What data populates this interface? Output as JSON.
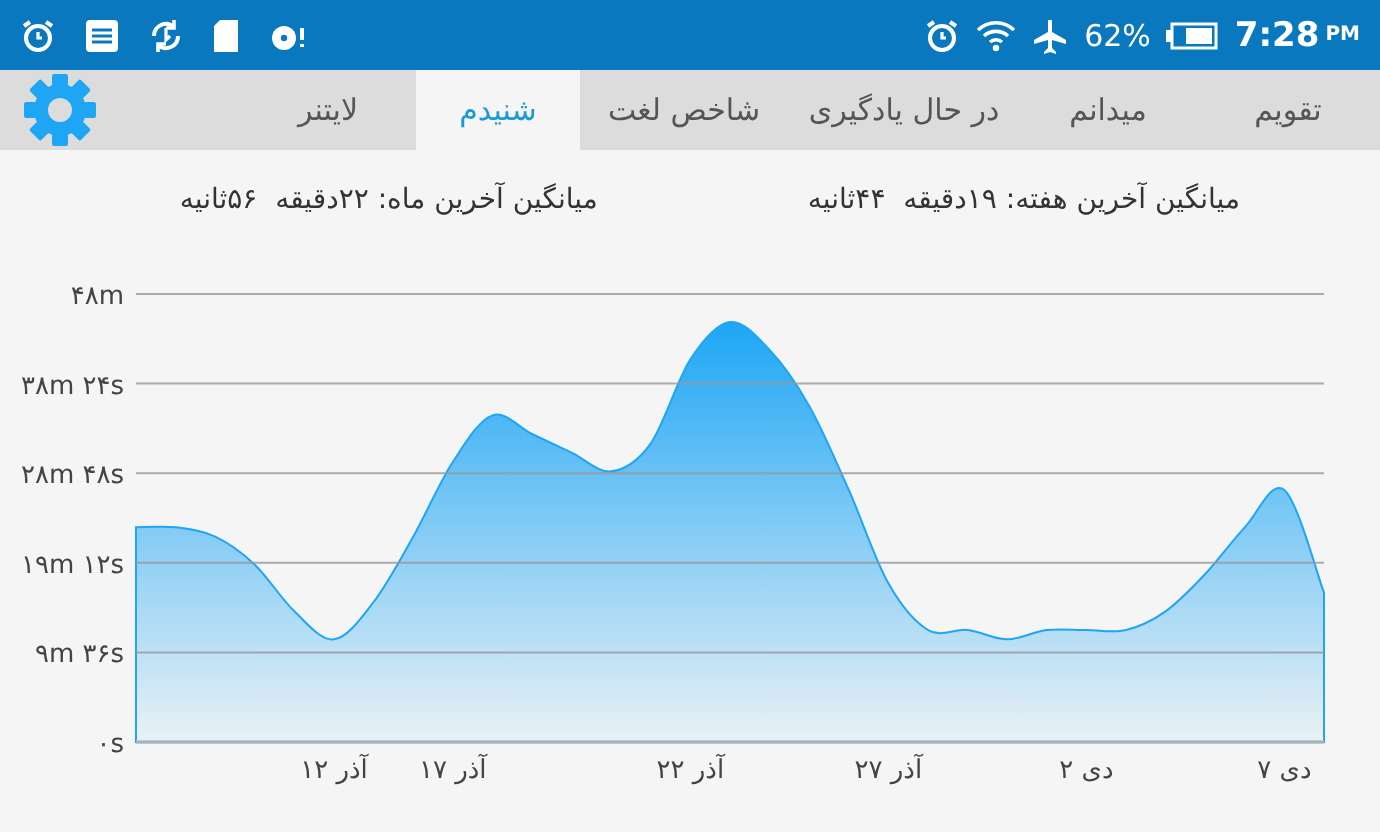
{
  "status_bar": {
    "battery": "62%",
    "time": "7:28",
    "ampm": "PM"
  },
  "tabs": [
    {
      "label": "تقویم",
      "selected": false
    },
    {
      "label": "میدانم",
      "selected": false
    },
    {
      "label": "در حال یادگیری",
      "selected": false
    },
    {
      "label": "شاخص لغت",
      "selected": false
    },
    {
      "label": "شنیدم",
      "selected": true
    },
    {
      "label": "لایتنر",
      "selected": false
    }
  ],
  "averages": [
    "میانگین آخرین هفته: ۱۹دقیقه  ۴۴ثانیه",
    "میانگین آخرین ماه: ۲۲دقیقه  ۵۶ثانیه"
  ],
  "chart_data": {
    "type": "area",
    "grid": true,
    "categories": [
      null,
      null,
      null,
      null,
      null,
      "۱۲ آذر",
      null,
      null,
      "۱۷ آذر",
      null,
      null,
      null,
      null,
      null,
      "۲۲ آذر",
      null,
      null,
      null,
      null,
      "۲۷ آذر",
      null,
      null,
      null,
      null,
      "۲ دی",
      null,
      null,
      null,
      null,
      "۷ دی",
      null
    ],
    "series": [
      {
        "color": "#1ea6f5",
        "values": [
          23,
          23,
          22,
          19,
          14,
          11,
          15,
          22,
          30,
          35,
          33,
          31,
          29,
          32,
          41,
          45,
          42,
          36,
          27,
          17,
          12,
          12,
          11,
          12,
          12,
          12,
          14,
          18,
          23,
          27,
          16
        ]
      }
    ],
    "ylim": [
      0,
      48
    ],
    "yticks": [
      {
        "value": 0,
        "label": "۰s"
      },
      {
        "value": 9.6,
        "label": "۹m ۳۶s"
      },
      {
        "value": 19.2,
        "label": "۱۹m ۱۲s"
      },
      {
        "value": 28.8,
        "label": "۲۸m ۴۸s"
      },
      {
        "value": 38.4,
        "label": "۳۸m ۲۴s"
      },
      {
        "value": 48,
        "label": "۴۸m"
      }
    ]
  }
}
